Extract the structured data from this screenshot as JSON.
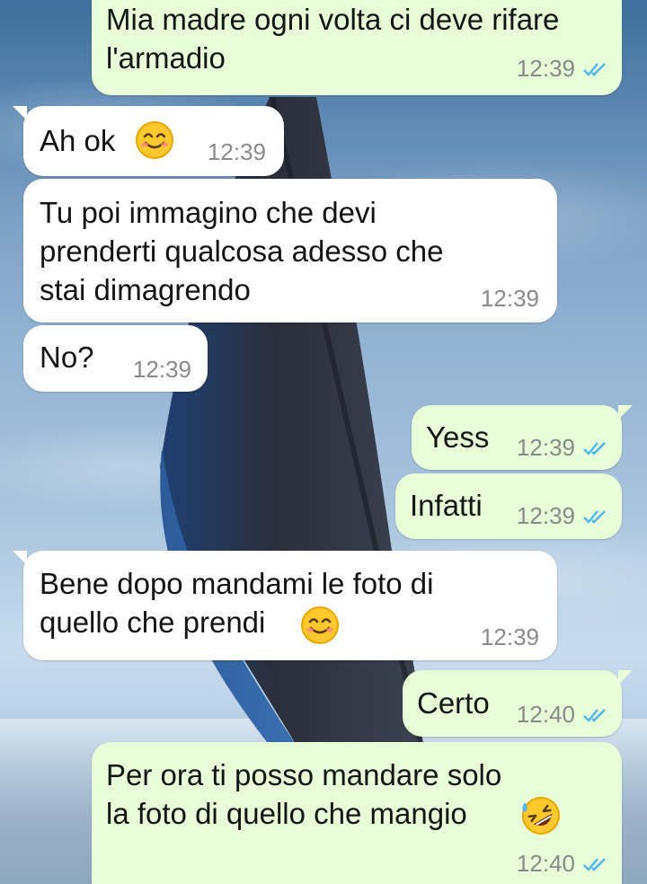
{
  "messages": [
    {
      "lines": [
        "Mia madre ogni volta ci deve rifare",
        "l'armadio"
      ],
      "time": "12:39"
    },
    {
      "lines": [
        "Ah ok"
      ],
      "time": "12:39",
      "emoji": "smiling-face-icon"
    },
    {
      "lines": [
        "Tu poi immagino che devi",
        "prenderti qualcosa adesso che",
        "stai dimagrendo"
      ],
      "time": "12:39"
    },
    {
      "lines": [
        "No?"
      ],
      "time": "12:39"
    },
    {
      "lines": [
        "Yess"
      ],
      "time": "12:39"
    },
    {
      "lines": [
        "Infatti"
      ],
      "time": "12:39"
    },
    {
      "lines": [
        "Bene dopo mandami le foto di",
        "quello che prendi"
      ],
      "time": "12:39",
      "emoji": "smiling-face-icon"
    },
    {
      "lines": [
        "Certo"
      ],
      "time": "12:40"
    },
    {
      "lines": [
        "Per ora ti posso mandare solo",
        "la foto di quello che mangio"
      ],
      "time": "12:40",
      "emoji": "rofl-face-icon"
    }
  ],
  "colors": {
    "incoming_bubble": "#ffffff",
    "outgoing_bubble": "#e7fed8",
    "read_ticks": "#4fb6ec",
    "timestamp": "#8a8a8a"
  }
}
